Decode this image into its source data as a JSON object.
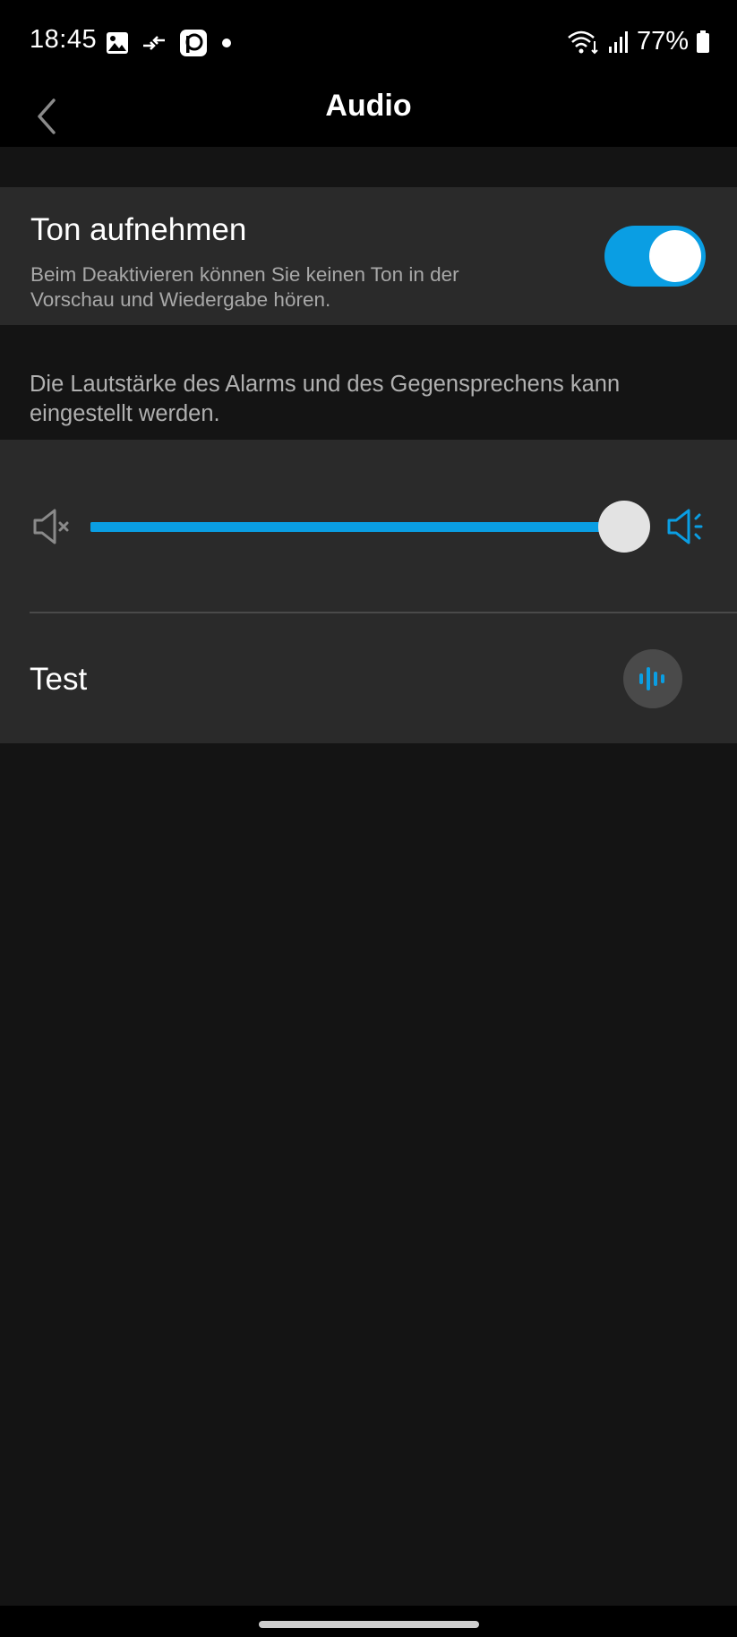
{
  "status_bar": {
    "time": "18:45",
    "battery": "77%",
    "icons": [
      "gallery-icon",
      "data-transfer-icon",
      "app-notification-icon",
      "dot-icon",
      "wifi-icon",
      "signal-icon",
      "battery-icon"
    ]
  },
  "app_bar": {
    "title": "Audio",
    "back_icon": "chevron-left-icon"
  },
  "record_sound": {
    "title": "Ton aufnehmen",
    "description": "Beim Deaktivieren können Sie keinen Ton in der Vorschau und Wiedergabe hören.",
    "enabled": true
  },
  "volume": {
    "info": "Die Lautstärke des Alarms und des Gegensprechens kann eingestellt werden.",
    "level": 1.0,
    "min_icon": "speaker-mute-icon",
    "max_icon": "speaker-volume-icon"
  },
  "test": {
    "label": "Test",
    "icon": "sound-wave-icon"
  },
  "colors": {
    "accent": "#0a9ee3",
    "background": "#141414",
    "card": "#2a2a2a",
    "secondary_text": "#a8a8a8"
  }
}
